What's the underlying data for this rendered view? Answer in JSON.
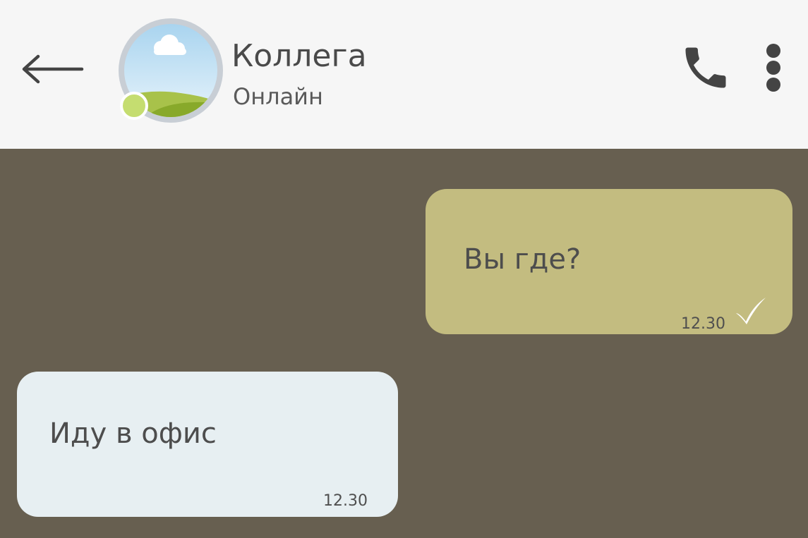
{
  "header": {
    "back_icon": "arrow-left-icon",
    "contact": {
      "name": "Коллега",
      "status": "Онлайн",
      "avatar": "landscape-avatar",
      "online_indicator_color": "#c5dd70"
    },
    "actions": [
      {
        "icon": "phone-icon"
      },
      {
        "icon": "more-vertical-icon"
      }
    ]
  },
  "messages": [
    {
      "direction": "outgoing",
      "text": "Вы где?",
      "time": "12.30",
      "status_icon": "check-icon",
      "bubble_color": "#c3bc80"
    },
    {
      "direction": "incoming",
      "text": "Иду в офис",
      "time": "12.30",
      "bubble_color": "#e7eff2"
    }
  ],
  "colors": {
    "header_bg": "#f6f6f6",
    "chat_bg": "#675f50"
  }
}
